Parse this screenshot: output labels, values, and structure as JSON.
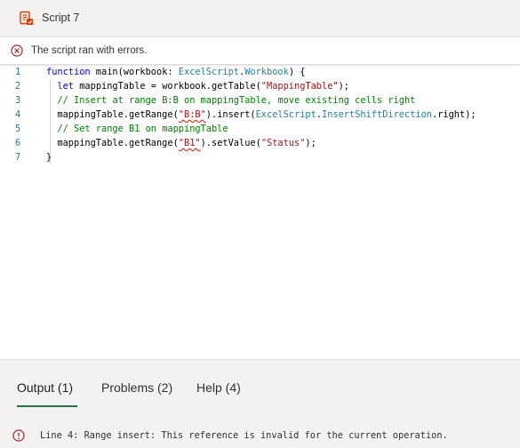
{
  "header": {
    "title": "Script 7"
  },
  "error_bar": {
    "message": "The script ran with errors."
  },
  "editor": {
    "lines": [
      {
        "number": "1",
        "tokens": [
          [
            "kw",
            "function "
          ],
          [
            "pl",
            "main(workbook: "
          ],
          [
            "ty",
            "ExcelScript"
          ],
          [
            "pl",
            "."
          ],
          [
            "ty",
            "Workbook"
          ],
          [
            "pl",
            ") {"
          ]
        ]
      },
      {
        "number": "2",
        "tokens": [
          [
            "pl",
            "  "
          ],
          [
            "kw",
            "let"
          ],
          [
            "pl",
            " mappingTable = workbook.getTable("
          ],
          [
            "str",
            "\"MappingTable\""
          ],
          [
            "pl",
            ");"
          ]
        ]
      },
      {
        "number": "3",
        "tokens": [
          [
            "pl",
            "  "
          ],
          [
            "cm",
            "// Insert at range B:B on mappingTable, move existing cells right"
          ]
        ]
      },
      {
        "number": "4",
        "tokens": [
          [
            "pl",
            "  mappingTable.getRange("
          ],
          [
            "strsq",
            "\"B:B\""
          ],
          [
            "pl",
            ").insert("
          ],
          [
            "ty",
            "ExcelScript"
          ],
          [
            "pl",
            "."
          ],
          [
            "ty",
            "InsertShiftDirection"
          ],
          [
            "pl",
            ".right);"
          ]
        ]
      },
      {
        "number": "5",
        "tokens": [
          [
            "pl",
            "  "
          ],
          [
            "cm",
            "// Set range B1 on mappingTable"
          ]
        ]
      },
      {
        "number": "6",
        "tokens": [
          [
            "pl",
            "  mappingTable.getRange("
          ],
          [
            "strsq",
            "\"B1\""
          ],
          [
            "pl",
            ").setValue("
          ],
          [
            "str",
            "\"Status\""
          ],
          [
            "pl",
            ");"
          ]
        ]
      },
      {
        "number": "7",
        "tokens": [
          [
            "pl",
            "}"
          ]
        ]
      }
    ]
  },
  "panel": {
    "tabs": [
      {
        "label": "Output (1)",
        "active": true
      },
      {
        "label": "Problems (2)",
        "active": false
      },
      {
        "label": "Help (4)",
        "active": false
      }
    ],
    "output_message": "Line 4: Range insert: This reference is invalid for the current operation."
  },
  "colors": {
    "accent": "#217346",
    "error": "#a4262c",
    "script_icon": "#d83b01"
  }
}
